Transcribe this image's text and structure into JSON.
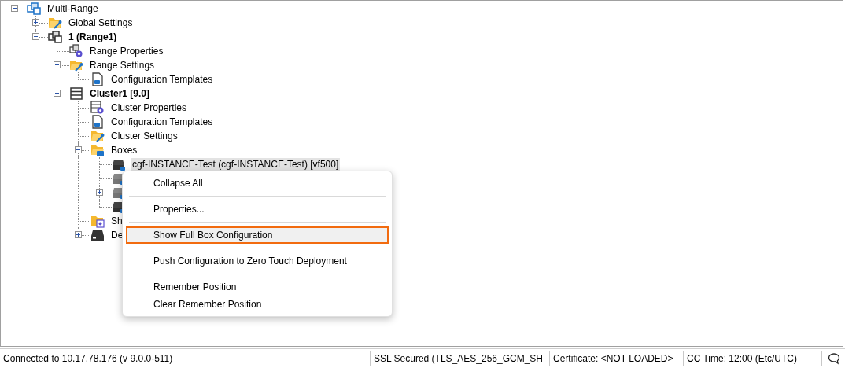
{
  "tree": {
    "nodes": [
      {
        "label": "Multi-Range",
        "kind": "multi-range",
        "expanded": true,
        "selected": false,
        "children": [
          {
            "label": "Global Settings",
            "kind": "folder-wrench",
            "expanded": false,
            "selected": false
          },
          {
            "label": "1 (Range1)",
            "bold": true,
            "kind": "range",
            "expanded": true,
            "selected": false,
            "children": [
              {
                "label": "Range Properties",
                "kind": "range-properties",
                "selected": false
              },
              {
                "label": "Range Settings",
                "kind": "folder-wrench",
                "expanded": true,
                "selected": false,
                "children": [
                  {
                    "label": "Configuration Templates",
                    "kind": "template",
                    "selected": false
                  }
                ]
              },
              {
                "label": "Cluster1 [9.0]",
                "bold": true,
                "kind": "cluster",
                "expanded": true,
                "selected": false,
                "children": [
                  {
                    "label": "Cluster Properties",
                    "kind": "cluster-properties",
                    "selected": false
                  },
                  {
                    "label": "Configuration Templates",
                    "kind": "template",
                    "selected": false
                  },
                  {
                    "label": "Cluster Settings",
                    "kind": "folder-wrench",
                    "selected": false
                  },
                  {
                    "label": "Boxes",
                    "kind": "folder-box",
                    "expanded": true,
                    "selected": false,
                    "children": [
                      {
                        "label": "cgf-INSTANCE-Test (cgf-INSTANCE-Test) [vf500]",
                        "kind": "box",
                        "selected": true
                      },
                      {
                        "kind": "box-grey",
                        "selected": false
                      },
                      {
                        "kind": "box-grey",
                        "expanded": false,
                        "selected": false
                      },
                      {
                        "kind": "box",
                        "selected": false
                      }
                    ]
                  },
                  {
                    "label": "Sh",
                    "kind": "folder-gear",
                    "selected": false
                  },
                  {
                    "label": "De",
                    "kind": "drive",
                    "expanded": false,
                    "selected": false
                  }
                ]
              }
            ]
          }
        ]
      }
    ]
  },
  "menu": {
    "items": [
      {
        "kind": "item",
        "label": "Collapse All",
        "selected": false
      },
      {
        "kind": "separator"
      },
      {
        "kind": "item",
        "label": "Properties...",
        "selected": false
      },
      {
        "kind": "separator"
      },
      {
        "kind": "item",
        "label": "Show Full Box Configuration",
        "selected": true
      },
      {
        "kind": "separator"
      },
      {
        "kind": "item",
        "label": "Push Configuration to Zero Touch Deployment",
        "selected": false
      },
      {
        "kind": "separator"
      },
      {
        "kind": "item",
        "label": "Remember Position",
        "selected": false
      },
      {
        "kind": "item",
        "label": "Clear Remember Position",
        "selected": false
      }
    ]
  },
  "status_bar": {
    "sections": [
      {
        "text": "Connected to 10.17.78.176 (v 9.0.0-511)"
      },
      {
        "text": "SSL Secured (TLS_AES_256_GCM_SH"
      },
      {
        "text": "Certificate: <NOT LOADED>"
      },
      {
        "text": "CC Time: 12:00 (Etc/UTC)"
      }
    ]
  }
}
